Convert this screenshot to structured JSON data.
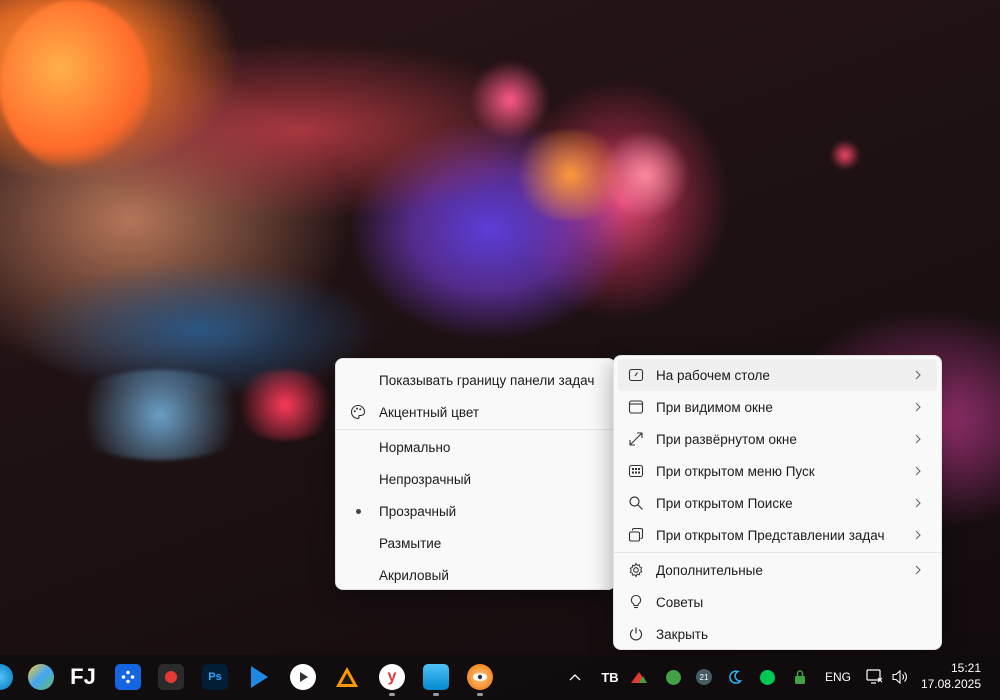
{
  "left_menu": {
    "items": [
      {
        "label": "Показывать границу панели задач",
        "icon": "none"
      },
      {
        "label": "Акцентный цвет",
        "icon": "palette-icon"
      },
      {
        "label": "Нормально",
        "icon": "none"
      },
      {
        "label": "Непрозрачный",
        "icon": "none"
      },
      {
        "label": "Прозрачный",
        "icon": "bullet-icon",
        "selected": true
      },
      {
        "label": "Размытие",
        "icon": "none"
      },
      {
        "label": "Акриловый",
        "icon": "none"
      }
    ]
  },
  "right_menu": {
    "items": [
      {
        "label": "На рабочем столе",
        "icon": "desktop-icon",
        "submenu": true
      },
      {
        "label": "При видимом окне",
        "icon": "window-icon",
        "submenu": true
      },
      {
        "label": "При развёрнутом окне",
        "icon": "maximize-diagonal-icon",
        "submenu": true
      },
      {
        "label": "При открытом меню Пуск",
        "icon": "start-menu-icon",
        "submenu": true
      },
      {
        "label": "При открытом Поиске",
        "icon": "search-icon",
        "submenu": true
      },
      {
        "label": "При открытом Представлении задач",
        "icon": "task-view-icon",
        "submenu": true
      },
      {
        "label": "Дополнительные",
        "icon": "gear-icon",
        "submenu": true
      },
      {
        "label": "Советы",
        "icon": "lightbulb-icon",
        "submenu": false
      },
      {
        "label": "Закрыть",
        "icon": "power-icon",
        "submenu": false
      }
    ]
  },
  "taskbar": {
    "apps": [
      "browser-app-icon",
      "paint-app-icon",
      "file-manager-app-icon",
      "remote-app-icon",
      "recorder-app-icon",
      "photoshop-app-icon",
      "play-app-icon",
      "media-player-app-icon",
      "vlc-app-icon",
      "yandex-browser-app-icon",
      "photos-app-icon",
      "eye-app-icon"
    ],
    "apps_text": {
      "fj": "FJ",
      "ps": "Ps"
    },
    "tray": {
      "language": "ENG",
      "badge_21": "21",
      "tb_label": "TB"
    },
    "clock": {
      "time": "15:21",
      "date": "17.08.2025"
    }
  },
  "colors": {
    "menu_bg": "#f9f9f9",
    "hover": "#f0f0f0",
    "taskbar": "#100c0e"
  }
}
